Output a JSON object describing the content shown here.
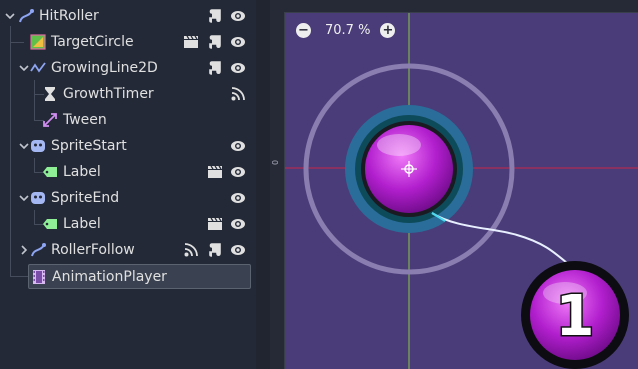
{
  "scene_tree": {
    "nodes": [
      {
        "name": "HitRoller",
        "icon": "path-follow-icon"
      },
      {
        "name": "TargetCircle",
        "icon": "sprite-texture-icon"
      },
      {
        "name": "GrowingLine2D",
        "icon": "line2d-icon"
      },
      {
        "name": "GrowthTimer",
        "icon": "hourglass-icon"
      },
      {
        "name": "Tween",
        "icon": "tween-icon"
      },
      {
        "name": "SpriteStart",
        "icon": "sprite-icon"
      },
      {
        "name": "Label",
        "icon": "label-tag-icon"
      },
      {
        "name": "SpriteEnd",
        "icon": "sprite-icon"
      },
      {
        "name": "Label",
        "icon": "label-tag-icon"
      },
      {
        "name": "RollerFollow",
        "icon": "path-follow-icon"
      },
      {
        "name": "AnimationPlayer",
        "icon": "film-icon"
      }
    ]
  },
  "viewport": {
    "zoom_label": "70.7 %",
    "zoom_out_glyph": "−",
    "zoom_in_glyph": "+",
    "ruler_origin_label": "0",
    "roller_number": "1"
  },
  "colors": {
    "panel_bg": "#232937",
    "viewport_bg": "#4a3c78",
    "accent_purple": "#b01ec9",
    "ring_teal": "#2a6d9a",
    "guide_red": "#c8284a",
    "guide_green": "#8cc84a"
  }
}
